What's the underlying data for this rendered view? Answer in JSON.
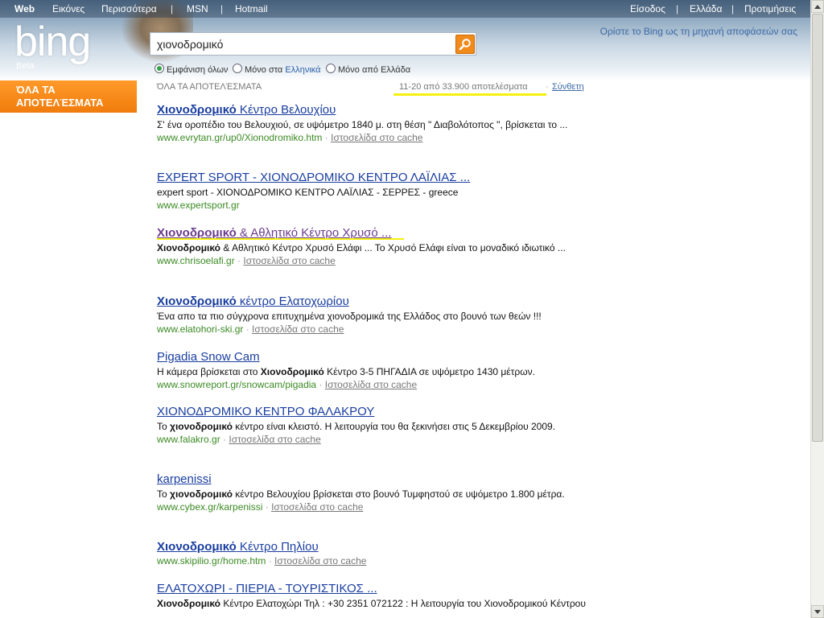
{
  "topnav": {
    "web": "Web",
    "images": "Εικόνες",
    "more": "Περισσότερα",
    "msn": "MSN",
    "hotmail": "Hotmail",
    "signin": "Είσοδος",
    "region": "Ελλάδα",
    "prefs": "Προτιμήσεις",
    "sep": "|"
  },
  "logo": {
    "text": "bing",
    "beta": "Beta"
  },
  "set_default": "Ορίστε το Bing ως τη μηχανή αποφάσεών σας",
  "search": {
    "value": "χιονοδρομικό"
  },
  "scope": {
    "all": "Εμφάνιση όλων",
    "greek_prefix": "Μόνο στα ",
    "greek_hl": "Ελληνικά",
    "greece": "Μόνο από Ελλάδα"
  },
  "leftnav": {
    "all_results": "ΌΛΑ ΤΑ ΑΠΟΤΕΛΈΣΜΑΤΑ"
  },
  "results_header": {
    "caption": "ΌΛΑ ΤΑ ΑΠΟΤΕΛΈΣΜΑΤΑ",
    "count": "11-20 από 33.900 αποτελέσματα",
    "dot": "·",
    "synth": "Σύνθετη"
  },
  "cache_label": "Ιστοσελίδα στο cache",
  "results": [
    {
      "title_bold": "Χιονοδρομικό",
      "title_rest": " Κέντρο Βελουχίου",
      "snippet": "Σ' ένα οροπέδιο του Βελουχιού, σε υψόμετρο 1840 μ. στη θέση \" Διαβολότοπος \", βρίσκεται το ...",
      "url": "www.evrytan.gr/up0/Xionodromiko.htm"
    },
    {
      "title_bold": "",
      "title_rest": "EXPERT SPORT - ΧΙΟΝΟΔΡΟΜΙΚΟ ΚΕΝΤΡΟ ΛΑΪΛΙΑΣ ...",
      "snippet": "expert sport - ΧΙΟΝΟΔΡΟΜΙΚΟ ΚΕΝΤΡΟ ΛΑΪΛΙΑΣ - ΣΕΡΡΕΣ - greece",
      "url": "www.expertsport.gr"
    },
    {
      "title_bold": "Χιονοδρομικό",
      "title_rest": " & Αθλητικό Κέντρο Χρυσό ...",
      "snippet_bold": "Χιονοδρομικό",
      "snippet": " & Αθλητικό Κέντρο Χρυσό Ελάφι ... Το Χρυσό Ελάφι είναι το μοναδικό ιδιωτικό ...",
      "url": "www.chrisoelafi.gr"
    },
    {
      "title_bold": "Χιονοδρομικό",
      "title_rest": " κέντρο Ελατοχωρίου",
      "snippet": "Ένα απο τα πιο σύγχρονα επιτυχημένα χιονοδρομικά της Ελλάδος στο βουνό των θεών !!!",
      "url": "www.elatohori-ski.gr"
    },
    {
      "title_bold": "",
      "title_rest": "Pigadia Snow Cam",
      "snippet_pre": "Η κάμερα βρίσκεται στο ",
      "snippet_bold": "Χιονοδρομικό",
      "snippet": " Κέντρο 3-5 ΠΗΓΑΔΙΑ σε υψόμετρο 1430 μέτρων.",
      "url": "www.snowreport.gr/snowcam/pigadia"
    },
    {
      "title_bold": "",
      "title_rest": "ΧΙΟΝΟΔΡΟΜΙΚΟ ΚΕΝΤΡΟ ΦΑΛΑΚΡΟΥ",
      "snippet_pre": "Το ",
      "snippet_bold": "χιονοδρομικό",
      "snippet": " κέντρο είναι κλειστό. Η λειτουργία του θα ξεκινήσει στις 5 Δεκεμβρίου 2009.",
      "url": "www.falakro.gr"
    },
    {
      "title_bold": "",
      "title_rest": "karpenissi",
      "snippet_pre": "Το ",
      "snippet_bold": "χιονοδρομικό",
      "snippet": " κέντρο Βελουχίου βρίσκεται στο βουνό Τυμφηστού σε υψόμετρο 1.800 μέτρα.",
      "url": "www.cybex.gr/karpenissi"
    },
    {
      "title_bold": "Χιονοδρομικό",
      "title_rest": " Κέντρο Πηλίου",
      "snippet": "",
      "url": "www.skipilio.gr/home.htm"
    },
    {
      "title_bold": "",
      "title_rest": "ΕΛΑΤΟΧΩΡΙ - ΠΙΕΡΙΑ - ΤΟΥΡΙΣΤΙΚΟΣ ...",
      "snippet_bold": "Χιονοδρομικό",
      "snippet": " Κέντρο Ελατοχώρι Τηλ : +30 2351 072122 : Η λειτουργία του Χιονοδρομικού Κέντρου",
      "url": ""
    }
  ],
  "colors": {
    "accent_orange": "#f08a1b",
    "link_blue": "#1a3ea0",
    "url_green": "#3c8a24",
    "highlight_yellow": "#f5f00e"
  }
}
